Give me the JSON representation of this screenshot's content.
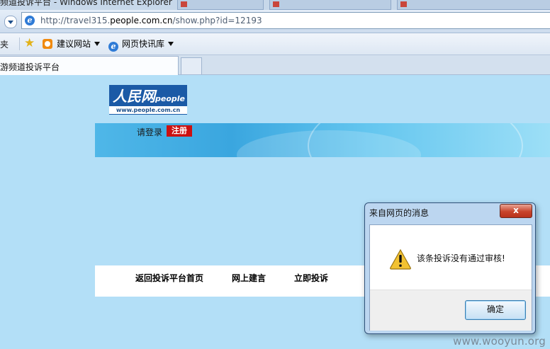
{
  "window": {
    "title": "频道投诉平台 - Windows Internet Explorer"
  },
  "background_tabs": [
    "",
    ""
  ],
  "address_bar": {
    "url_prefix": "http://travel315.",
    "url_domain": "people.com.cn",
    "url_suffix": "/show.php?id=12193"
  },
  "favorites_bar": {
    "label": "夹",
    "items": [
      {
        "label": "建议网站",
        "icon": "bing-favicon-icon"
      },
      {
        "label": "网页快讯库",
        "icon": "ie-icon"
      }
    ]
  },
  "tabs": {
    "active_label": "游频道投诉平台"
  },
  "page": {
    "logo": {
      "main": "人民网",
      "sub": "people",
      "url": "www.people.com.cn"
    },
    "banner": {
      "login_text": "请登录",
      "register_label": "注册"
    },
    "nav": [
      "返回投诉平台首页",
      "网上建言",
      "立即投诉"
    ]
  },
  "dialog": {
    "title": "来自网页的消息",
    "close_label": "x",
    "icon": "warning-icon",
    "message": "该条投诉没有通过审核!",
    "ok_label": "确定"
  },
  "watermark": "www.wooyun.org",
  "colors": {
    "page_background": "#b3dff7",
    "register_red": "#cc1010",
    "logo_blue": "#1b5aa6"
  }
}
